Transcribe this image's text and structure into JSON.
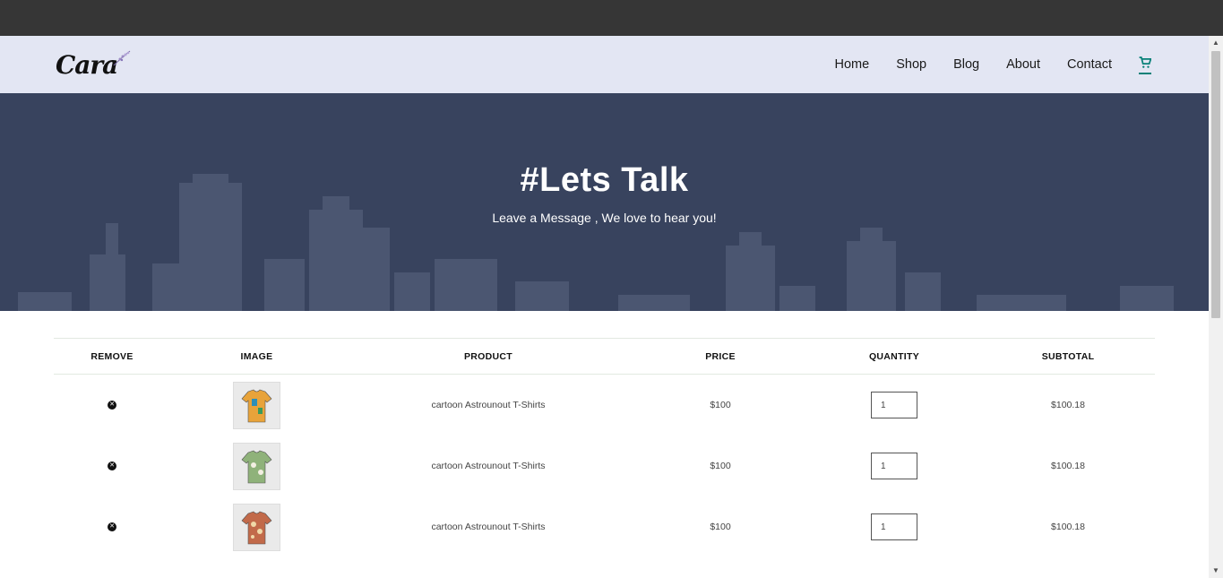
{
  "header": {
    "logo_text": "Cara",
    "nav": [
      "Home",
      "Shop",
      "Blog",
      "About",
      "Contact"
    ]
  },
  "hero": {
    "title": "#Lets Talk",
    "subtitle": "Leave a Message , We love to hear you!"
  },
  "table": {
    "headers": [
      "REMOVE",
      "IMAGE",
      "PRODUCT",
      "PRICE",
      "QUANTITY",
      "SUBTOTAL"
    ],
    "rows": [
      {
        "product": "cartoon Astrounout T-Shirts",
        "price": "$100",
        "quantity": "1",
        "subtotal": "$100.18",
        "shirt_color": "#e8a33a"
      },
      {
        "product": "cartoon Astrounout T-Shirts",
        "price": "$100",
        "quantity": "1",
        "subtotal": "$100.18",
        "shirt_color": "#8fb27a"
      },
      {
        "product": "cartoon Astrounout T-Shirts",
        "price": "$100",
        "quantity": "1",
        "subtotal": "$100.18",
        "shirt_color": "#c26a4a"
      }
    ]
  },
  "colors": {
    "header_bg": "#e3e6f3",
    "accent": "#088178",
    "hero_bg": "#3b4660"
  }
}
